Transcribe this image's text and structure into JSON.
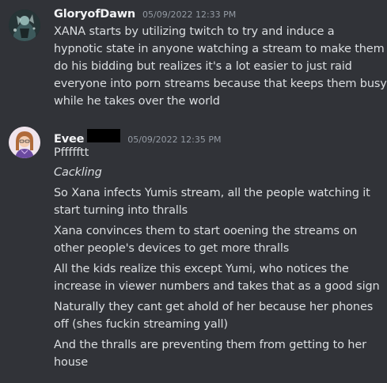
{
  "messages": [
    {
      "author": "GloryofDawn",
      "timestamp": "05/09/2022 12:33 PM",
      "avatar_icon": "gloryofdawn-avatar-icon",
      "lines": [
        "XANA starts by utilizing twitch to try and induce a",
        "hypnotic state in anyone watching a stream to make them",
        "do his bidding but realizes it's a lot easier to just raid",
        "everyone into porn streams because that keeps them busy",
        "while he takes over the world"
      ]
    },
    {
      "author": "Evee",
      "timestamp": "05/09/2022 12:35 PM",
      "avatar_icon": "evee-avatar-icon",
      "lines": [
        "Pffffftt",
        "Cackling",
        "So Xana infects Yumis stream, all the people watching it",
        "start turning into thralls",
        "Xana convinces them to start ooening the streams on",
        "other people's devices to get more thralls",
        "All the kids realize this except Yumi, who notices the",
        "increase in viewer numbers and takes that as a good sign",
        "Naturally they cant get ahold of her because her phones",
        "off (shes fuckin streaming yall)",
        "And the thralls are preventing them from getting to her",
        "house"
      ]
    }
  ],
  "colors": {
    "background": "#313338",
    "username": "#f2f3f5",
    "timestamp": "#949ba4",
    "message_text": "#dbdee1",
    "redaction": "#000000"
  }
}
